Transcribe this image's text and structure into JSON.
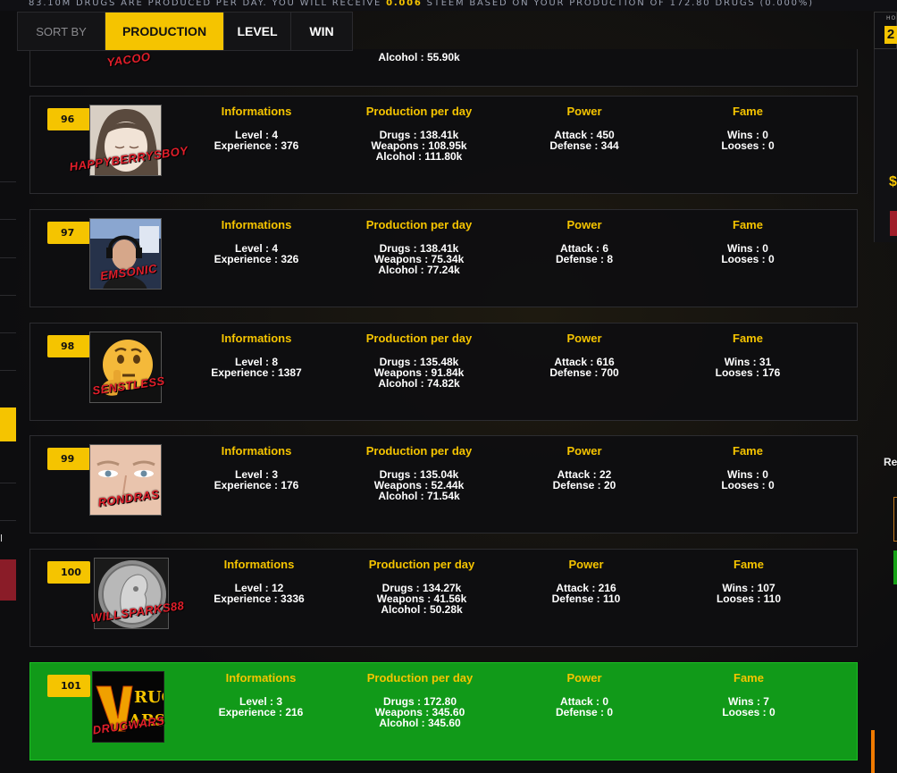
{
  "top_banner": {
    "prefix": "83.10M DRUGS ARE PRODUCED PER DAY. YOU WILL RECEIVE ",
    "amount": "0.006",
    "suffix": " STEEM BASED ON YOUR PRODUCTION OF 172.80 DRUGS (0.000%)"
  },
  "sort": {
    "label": "SORT BY",
    "tabs": [
      "PRODUCTION",
      "LEVEL",
      "WIN"
    ],
    "active": "PRODUCTION"
  },
  "headers": {
    "informations": "Informations",
    "production": "Production per day",
    "power": "Power",
    "fame": "Fame"
  },
  "partial_row": {
    "username": "YACOO",
    "alcohol": "Alcohol : 55.90k"
  },
  "players": [
    {
      "rank": "96",
      "username": "HAPPYBERRYSBOY",
      "avatar": "anime-face-avatar",
      "level": "Level : 4",
      "experience": "Experience : 376",
      "drugs": "Drugs : 138.41k",
      "weapons": "Weapons : 108.95k",
      "alcohol": "Alcohol : 111.80k",
      "attack": "Attack : 450",
      "defense": "Defense : 344",
      "wins": "Wins : 0",
      "looses": "Looses : 0"
    },
    {
      "rank": "97",
      "username": "EMSONIC",
      "avatar": "man-headset-avatar",
      "level": "Level : 4",
      "experience": "Experience : 326",
      "drugs": "Drugs : 138.41k",
      "weapons": "Weapons : 75.34k",
      "alcohol": "Alcohol : 77.24k",
      "attack": "Attack : 6",
      "defense": "Defense : 8",
      "wins": "Wins : 0",
      "looses": "Looses : 0"
    },
    {
      "rank": "98",
      "username": "SENSTLESS",
      "avatar": "thinking-emoji-avatar",
      "level": "Level : 8",
      "experience": "Experience : 1387",
      "drugs": "Drugs : 135.48k",
      "weapons": "Weapons : 91.84k",
      "alcohol": "Alcohol : 74.82k",
      "attack": "Attack : 616",
      "defense": "Defense : 700",
      "wins": "Wins : 31",
      "looses": "Looses : 176"
    },
    {
      "rank": "99",
      "username": "RONDRAS",
      "avatar": "eyes-closeup-avatar",
      "level": "Level : 3",
      "experience": "Experience : 176",
      "drugs": "Drugs : 135.04k",
      "weapons": "Weapons : 52.44k",
      "alcohol": "Alcohol : 71.54k",
      "attack": "Attack : 22",
      "defense": "Defense : 20",
      "wins": "Wins : 0",
      "looses": "Looses : 0"
    },
    {
      "rank": "100",
      "username": "WILLSPARKS88",
      "avatar": "silver-coin-avatar",
      "level": "Level : 12",
      "experience": "Experience : 3336",
      "drugs": "Drugs : 134.27k",
      "weapons": "Weapons : 41.56k",
      "alcohol": "Alcohol : 50.28k",
      "attack": "Attack : 216",
      "defense": "Defense : 110",
      "wins": "Wins : 107",
      "looses": "Looses : 110"
    },
    {
      "rank": "101",
      "username": "DRUGWARS",
      "avatar": "drugwars-logo-avatar",
      "logo_text": "DRUG WARS",
      "level": "Level : 3",
      "experience": "Experience : 216",
      "drugs": "Drugs : 172.80",
      "weapons": "Weapons : 345.60",
      "alcohol": "Alcohol : 345.60",
      "attack": "Attack : 0",
      "defense": "Defense : 0",
      "wins": "Wins : 7",
      "looses": "Looses : 0",
      "highlight": true
    }
  ],
  "right_panel": {
    "badge": "2",
    "small_label": "HO",
    "dollar": "$",
    "re_label": "Re"
  },
  "left_panel": {
    "char": "l"
  },
  "colors": {
    "accent": "#f5c400",
    "username": "#e01e2a",
    "highlight_row": "#119a19"
  }
}
